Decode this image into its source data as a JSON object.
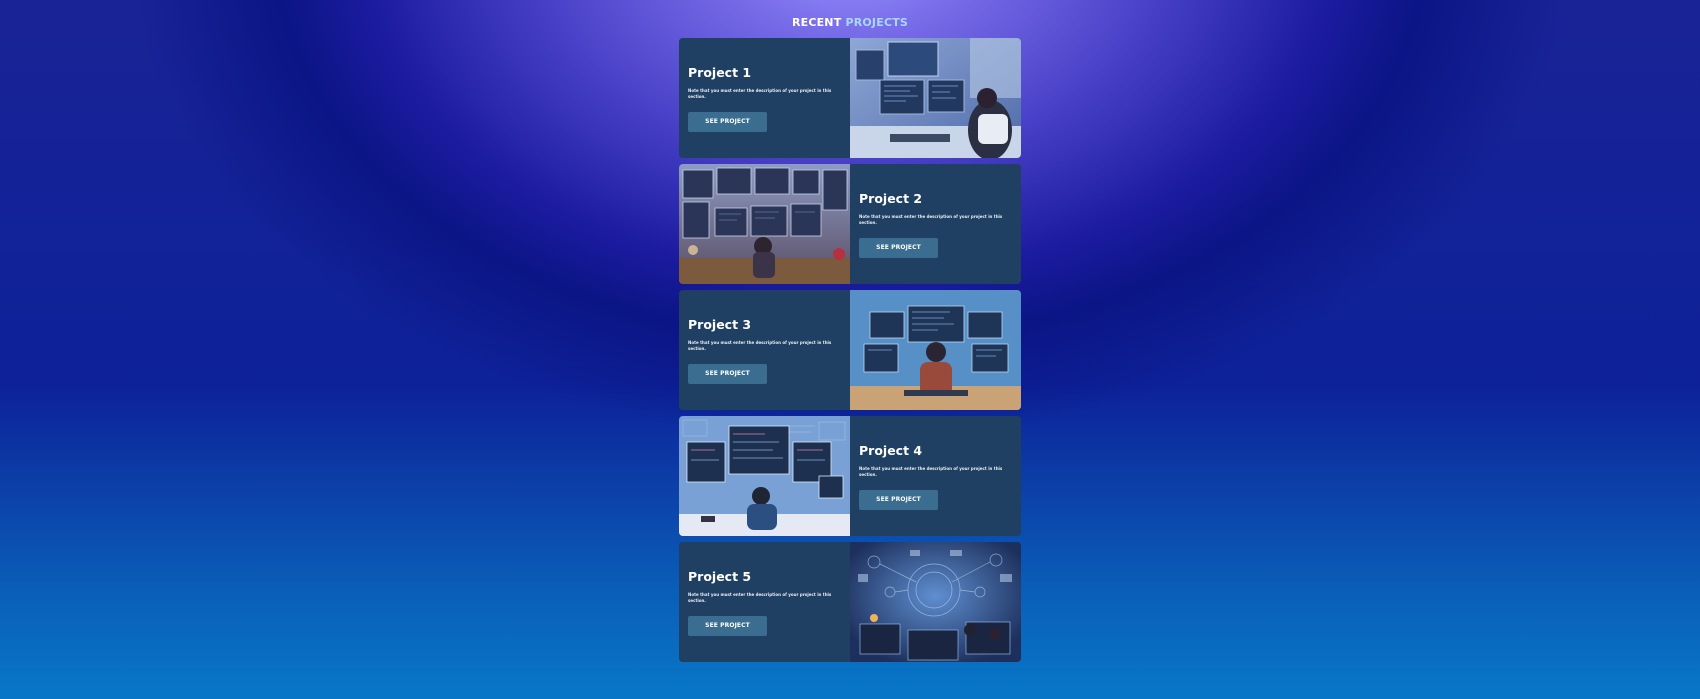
{
  "heading": {
    "part1": "RECENT",
    "part2": "PROJECTS"
  },
  "colors": {
    "card_bg": "#1f3f63",
    "button_bg": "#3a6d8f",
    "heading_accent": "#a9d8ff"
  },
  "projects": [
    {
      "title": "Project 1",
      "description": "Note that you must enter the description of your project in this section.",
      "button": "SEE PROJECT",
      "image": "developer-at-desk-image"
    },
    {
      "title": "Project 2",
      "description": "Note that you must enter the description of your project in this section.",
      "button": "SEE PROJECT",
      "image": "multi-monitor-workstation-image"
    },
    {
      "title": "Project 3",
      "description": "Note that you must enter the description of your project in this section.",
      "button": "SEE PROJECT",
      "image": "programmer-illustration-image"
    },
    {
      "title": "Project 4",
      "description": "Note that you must enter the description of your project in this section.",
      "button": "SEE PROJECT",
      "image": "coding-setup-illustration-image"
    },
    {
      "title": "Project 5",
      "description": "Note that you must enter the description of your project in this section.",
      "button": "SEE PROJECT",
      "image": "tech-network-image"
    }
  ]
}
